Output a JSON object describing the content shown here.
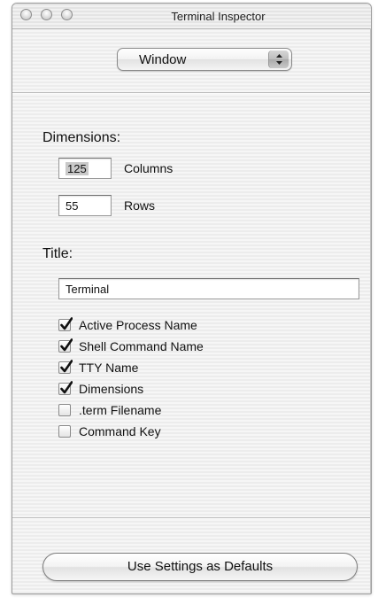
{
  "window": {
    "title": "Terminal Inspector"
  },
  "inspector_popup": {
    "selected": "Window"
  },
  "dimensions": {
    "label": "Dimensions:",
    "columns_value": "125",
    "columns_label": "Columns",
    "rows_value": "55",
    "rows_label": "Rows"
  },
  "title_section": {
    "label": "Title:",
    "title_value": "Terminal",
    "options": [
      {
        "label": "Active Process Name",
        "checked": true
      },
      {
        "label": "Shell Command Name",
        "checked": true
      },
      {
        "label": "TTY Name",
        "checked": true
      },
      {
        "label": "Dimensions",
        "checked": true
      },
      {
        "label": ".term Filename",
        "checked": false
      },
      {
        "label": "Command Key",
        "checked": false
      }
    ]
  },
  "footer": {
    "defaults_button_label": "Use Settings as Defaults"
  },
  "icons": {
    "traffic_lights": [
      "close-icon",
      "minimize-icon",
      "zoom-icon"
    ],
    "popup_arrows": "updown-arrows-icon",
    "checkmark": "checkmark-icon"
  }
}
